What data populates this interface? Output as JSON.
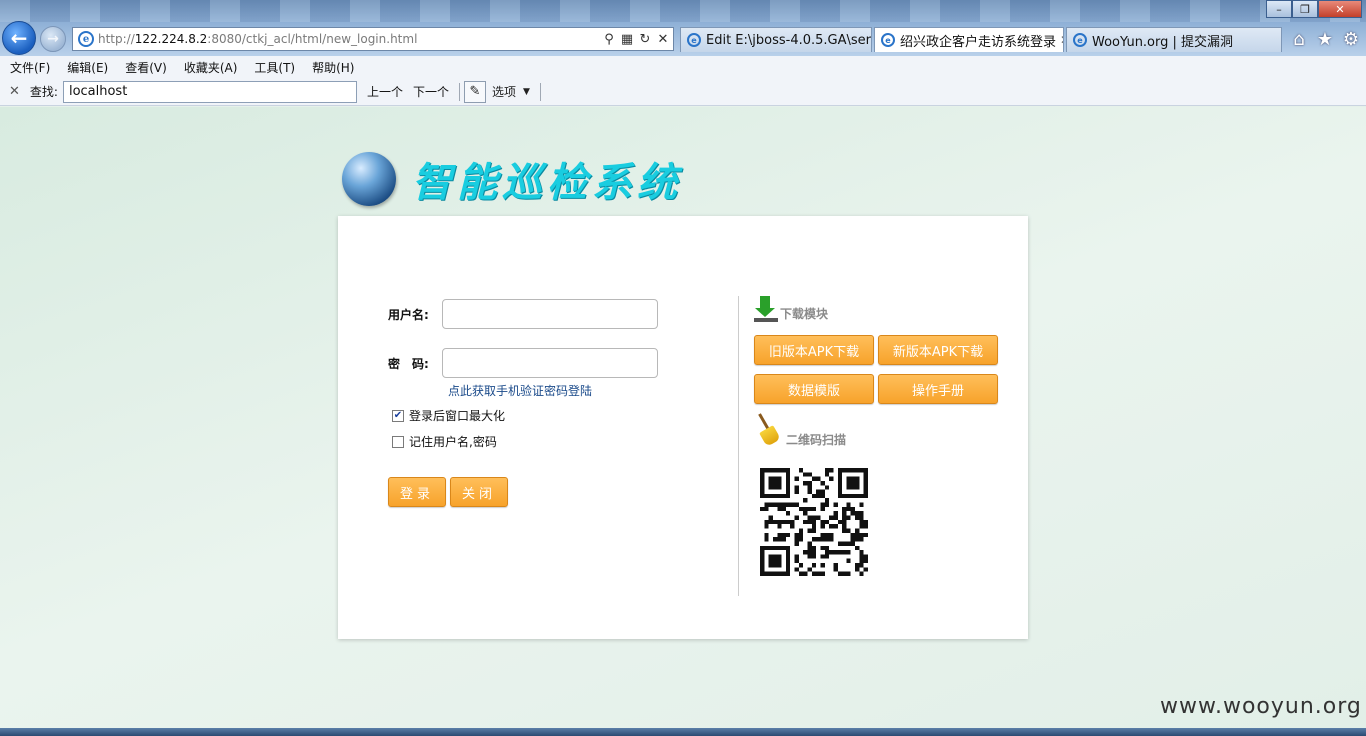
{
  "browser": {
    "address": {
      "url_prefix": "http://",
      "url_host": "122.224.8.2",
      "url_rest": ":8080/ctkj_acl/html/new_login.html"
    },
    "tabs": [
      {
        "label": "Edit E:\\jboss-4.0.5.GA\\serv..."
      },
      {
        "label": "绍兴政企客户走访系统登录"
      },
      {
        "label": "WooYun.org | 提交漏洞"
      }
    ],
    "menu": [
      "文件(F)",
      "编辑(E)",
      "查看(V)",
      "收藏夹(A)",
      "工具(T)",
      "帮助(H)"
    ],
    "find": {
      "label": "查找:",
      "value": "localhost",
      "prev": "上一个",
      "next": "下一个",
      "options": "选项"
    }
  },
  "page": {
    "logo_title": "智能巡检系统",
    "login": {
      "username_label": "用户名:",
      "password_label": "密　码:",
      "sms_link": "点此获取手机验证密码登陆",
      "maximize_label": "登录后窗口最大化",
      "maximize_checked": true,
      "remember_label": "记住用户名,密码",
      "remember_checked": false,
      "login_button": "登录",
      "close_button": "关闭"
    },
    "download": {
      "heading": "下载模块",
      "old_apk": "旧版本APK下载",
      "new_apk": "新版本APK下载",
      "template": "数据模版",
      "manual": "操作手册"
    },
    "qr": {
      "heading": "二维码扫描"
    }
  },
  "watermark": "www.wooyun.org",
  "colors": {
    "accent_orange": "#f7a32b",
    "logo_cyan": "#19cde0",
    "page_bg": "#e6f1ea"
  }
}
